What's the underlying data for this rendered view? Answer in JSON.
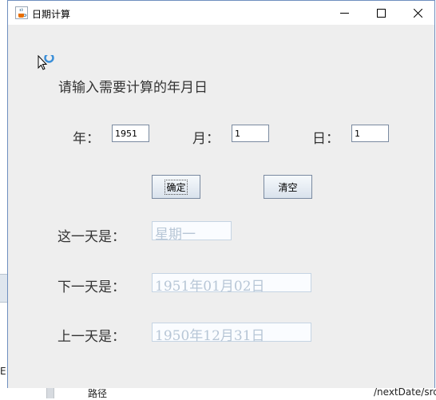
{
  "window": {
    "title": "日期计算"
  },
  "form": {
    "prompt": "请输入需要计算的年月日",
    "year_label": "年：",
    "year_value": "1951",
    "month_label": "月：",
    "month_value": "1",
    "day_label": "日：",
    "day_value": "1",
    "confirm_label": "确定",
    "clear_label": "清空"
  },
  "results": {
    "today_label": "这一天是：",
    "today_value": "星期一",
    "next_label": "下一天是：",
    "next_value": "1951年01月02日",
    "prev_label": "上一天是：",
    "prev_value": "1950年12月31日"
  },
  "background_app": {
    "left_char": "E",
    "bottom_left_text": "路径",
    "bottom_right_text": "/nextDate/src"
  },
  "colors": {
    "window_bg": "#eeeeee",
    "accent_border": "#6f8fbf",
    "output_text": "#b7c6d6",
    "cursor_ring": "#3b8fd8"
  },
  "icons": {
    "app": "java-cup-icon",
    "minimize": "minimize-icon",
    "maximize": "maximize-icon",
    "close": "close-icon",
    "cursor": "busy-cursor-icon"
  }
}
